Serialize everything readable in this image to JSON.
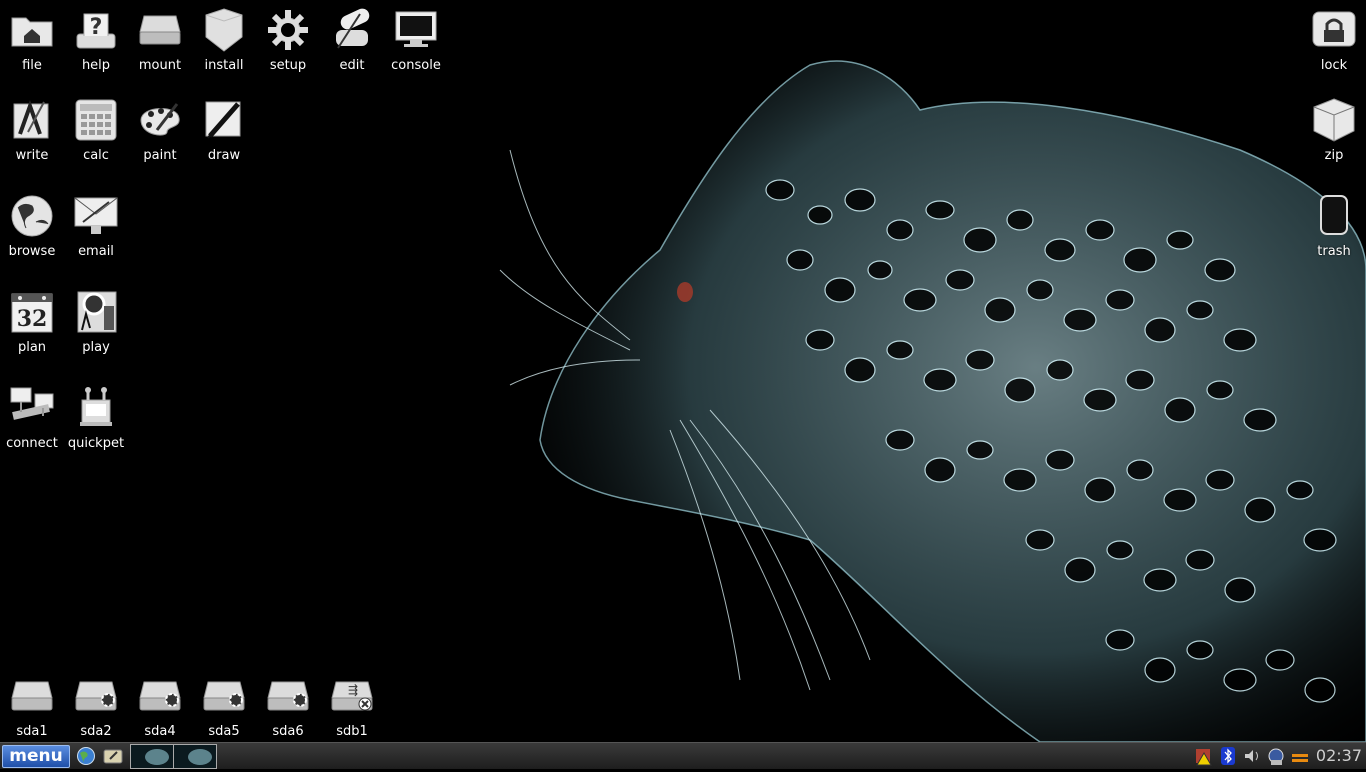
{
  "desktop": {
    "left_icons": [
      {
        "label": "file",
        "icon": "folder-home-icon"
      },
      {
        "label": "help",
        "icon": "help-icon"
      },
      {
        "label": "mount",
        "icon": "drive-icon"
      },
      {
        "label": "install",
        "icon": "install-box-icon"
      },
      {
        "label": "setup",
        "icon": "gear-icon"
      },
      {
        "label": "edit",
        "icon": "edit-quill-icon"
      },
      {
        "label": "console",
        "icon": "console-monitor-icon"
      },
      {
        "label": "write",
        "icon": "write-icon"
      },
      {
        "label": "calc",
        "icon": "calculator-icon"
      },
      {
        "label": "paint",
        "icon": "palette-icon"
      },
      {
        "label": "draw",
        "icon": "draw-icon"
      },
      {
        "label": "browse",
        "icon": "globe-icon"
      },
      {
        "label": "email",
        "icon": "email-icon"
      },
      {
        "label": "plan",
        "icon": "calendar-icon",
        "badge": "32"
      },
      {
        "label": "play",
        "icon": "media-player-icon"
      },
      {
        "label": "connect",
        "icon": "network-icon"
      },
      {
        "label": "quickpet",
        "icon": "quickpet-icon"
      }
    ],
    "right_icons": [
      {
        "label": "lock",
        "icon": "lock-icon"
      },
      {
        "label": "zip",
        "icon": "zip-box-icon"
      },
      {
        "label": "trash",
        "icon": "trash-icon"
      }
    ],
    "drives": [
      {
        "label": "sda1",
        "icon": "drive-icon"
      },
      {
        "label": "sda2",
        "icon": "drive-mounted-icon"
      },
      {
        "label": "sda4",
        "icon": "drive-mounted-icon"
      },
      {
        "label": "sda5",
        "icon": "drive-mounted-icon"
      },
      {
        "label": "sda6",
        "icon": "drive-mounted-icon"
      },
      {
        "label": "sdb1",
        "icon": "usb-drive-icon"
      }
    ]
  },
  "taskbar": {
    "menu_label": "menu",
    "clock": "02:37",
    "accent": "#2a5fc0"
  }
}
